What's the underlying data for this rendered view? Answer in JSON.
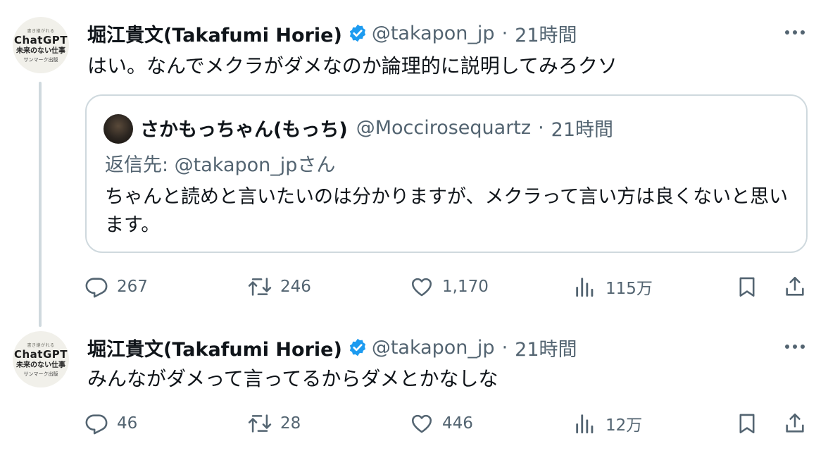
{
  "tweets": [
    {
      "avatar": {
        "line1": "書き継がれる",
        "title": "ChatGPT",
        "subtitle": "未来のない仕事",
        "publisher": "サンマーク出版"
      },
      "name": "堀江貴文(Takafumi Horie)",
      "handle": "@takapon_jp",
      "dot": "·",
      "time": "21時間",
      "text": "はい。なんでメクラがダメなのか論理的に説明してみろクソ",
      "quote": {
        "name": "さかもっちゃん(もっち)",
        "handle": "@Moccirosequartz",
        "dot": "·",
        "time": "21時間",
        "reply_to": "返信先: @takapon_jpさん",
        "text": "ちゃんと読めと言いたいのは分かりますが、メクラって言い方は良くないと思います。"
      },
      "actions": {
        "replies": "267",
        "retweets": "246",
        "likes": "1,170",
        "views": "115万"
      }
    },
    {
      "avatar": {
        "line1": "書き継がれる",
        "title": "ChatGPT",
        "subtitle": "未来のない仕事",
        "publisher": "サンマーク出版"
      },
      "name": "堀江貴文(Takafumi Horie)",
      "handle": "@takapon_jp",
      "dot": "·",
      "time": "21時間",
      "text": "みんながダメって言ってるからダメとかなしな",
      "actions": {
        "replies": "46",
        "retweets": "28",
        "likes": "446",
        "views": "12万"
      }
    }
  ],
  "colors": {
    "text": "#0f1419",
    "secondary": "#536471",
    "verified": "#1d9bf0",
    "border": "#cfd9de"
  },
  "icons": [
    "verified-badge-icon",
    "more-icon",
    "reply-icon",
    "retweet-icon",
    "like-icon",
    "views-icon",
    "bookmark-icon",
    "share-icon"
  ]
}
